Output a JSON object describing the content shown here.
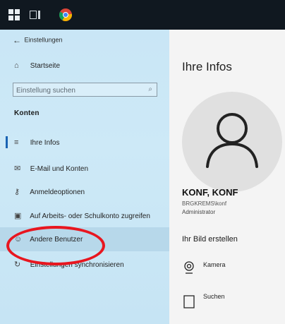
{
  "window": {
    "back_label": "Einstellungen"
  },
  "sidebar": {
    "home_label": "Startseite",
    "search_placeholder": "Einstellung suchen",
    "section_title": "Konten",
    "items": [
      {
        "label": "Ihre Infos",
        "icon": "person-card-icon"
      },
      {
        "label": "E-Mail und Konten",
        "icon": "mail-icon"
      },
      {
        "label": "Anmeldeoptionen",
        "icon": "key-icon"
      },
      {
        "label": "Auf Arbeits- oder Schulkonto zugreifen",
        "icon": "briefcase-icon"
      },
      {
        "label": "Andere Benutzer",
        "icon": "person-add-icon"
      },
      {
        "label": "Einstellungen synchronisieren",
        "icon": "sync-icon"
      }
    ]
  },
  "main": {
    "title": "Ihre Infos",
    "user_name": "KONF, KONF",
    "user_account": "BRGKREMS\\konf",
    "user_role": "Administrator",
    "create_picture_title": "Ihr Bild erstellen",
    "options": [
      {
        "label": "Kamera",
        "icon": "camera-icon"
      },
      {
        "label": "Suchen",
        "icon": "browse-file-icon"
      }
    ]
  },
  "colors": {
    "sidebar_bg": "#c9e6f6",
    "accent": "#1a63b3",
    "annotation": "#e8161f",
    "taskbar": "#101820"
  }
}
